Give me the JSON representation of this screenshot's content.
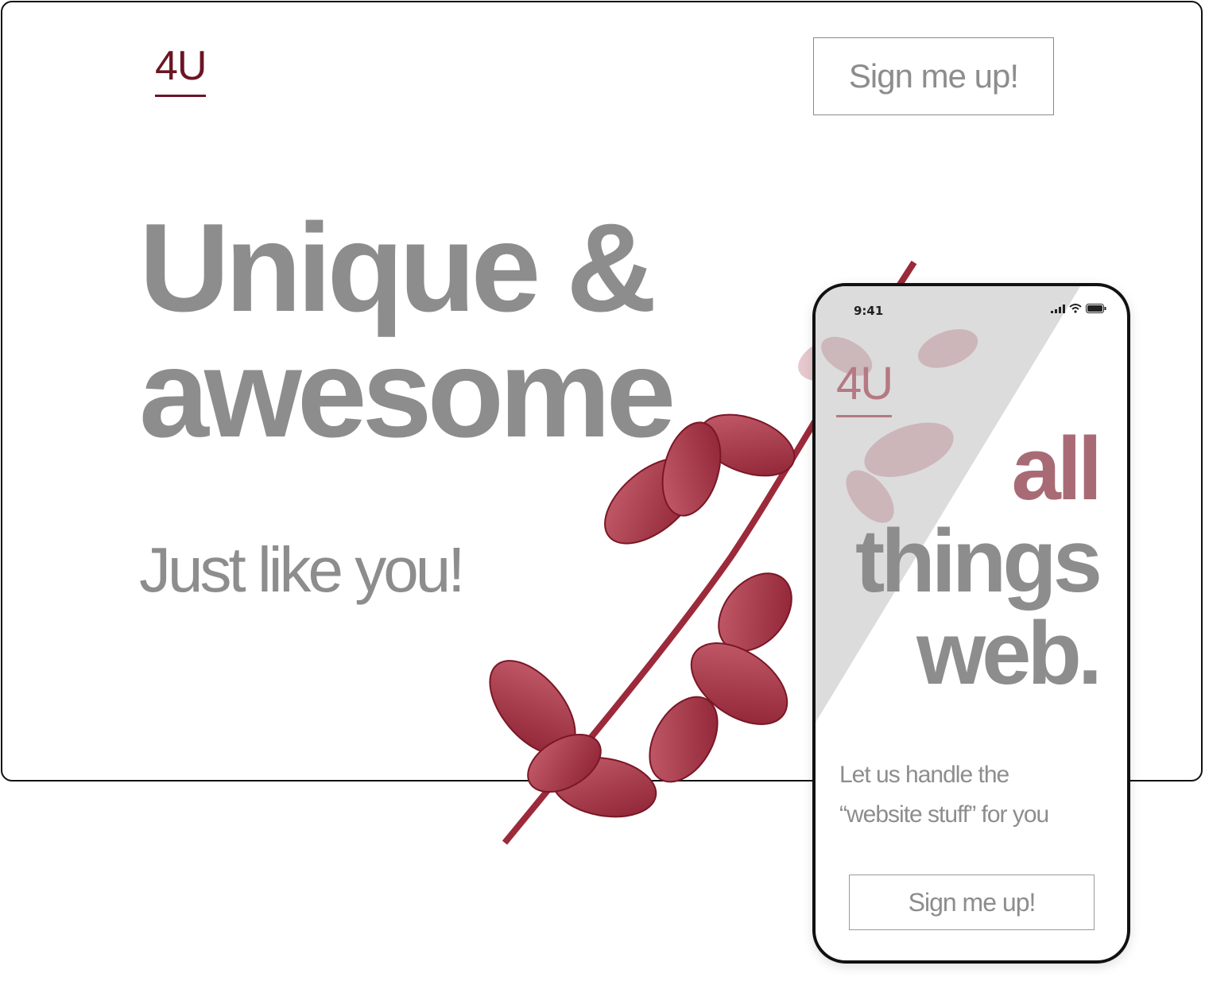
{
  "desktop": {
    "logo": "4U",
    "signup_button": "Sign me up!",
    "hero_line1": "Unique &",
    "hero_line2": "awesome",
    "subtitle": "Just like you!"
  },
  "phone": {
    "status_time": "9:41",
    "logo": "4U",
    "title_accent": "all",
    "title_line2": "things",
    "title_line3": "web.",
    "subtitle_line1": "Let us handle the",
    "subtitle_line2": "“website stuff” for you",
    "signup_button": "Sign me up!"
  },
  "colors": {
    "brand": "#6b1623",
    "accent": "#a86b76",
    "text_gray": "#8d8d8d"
  }
}
